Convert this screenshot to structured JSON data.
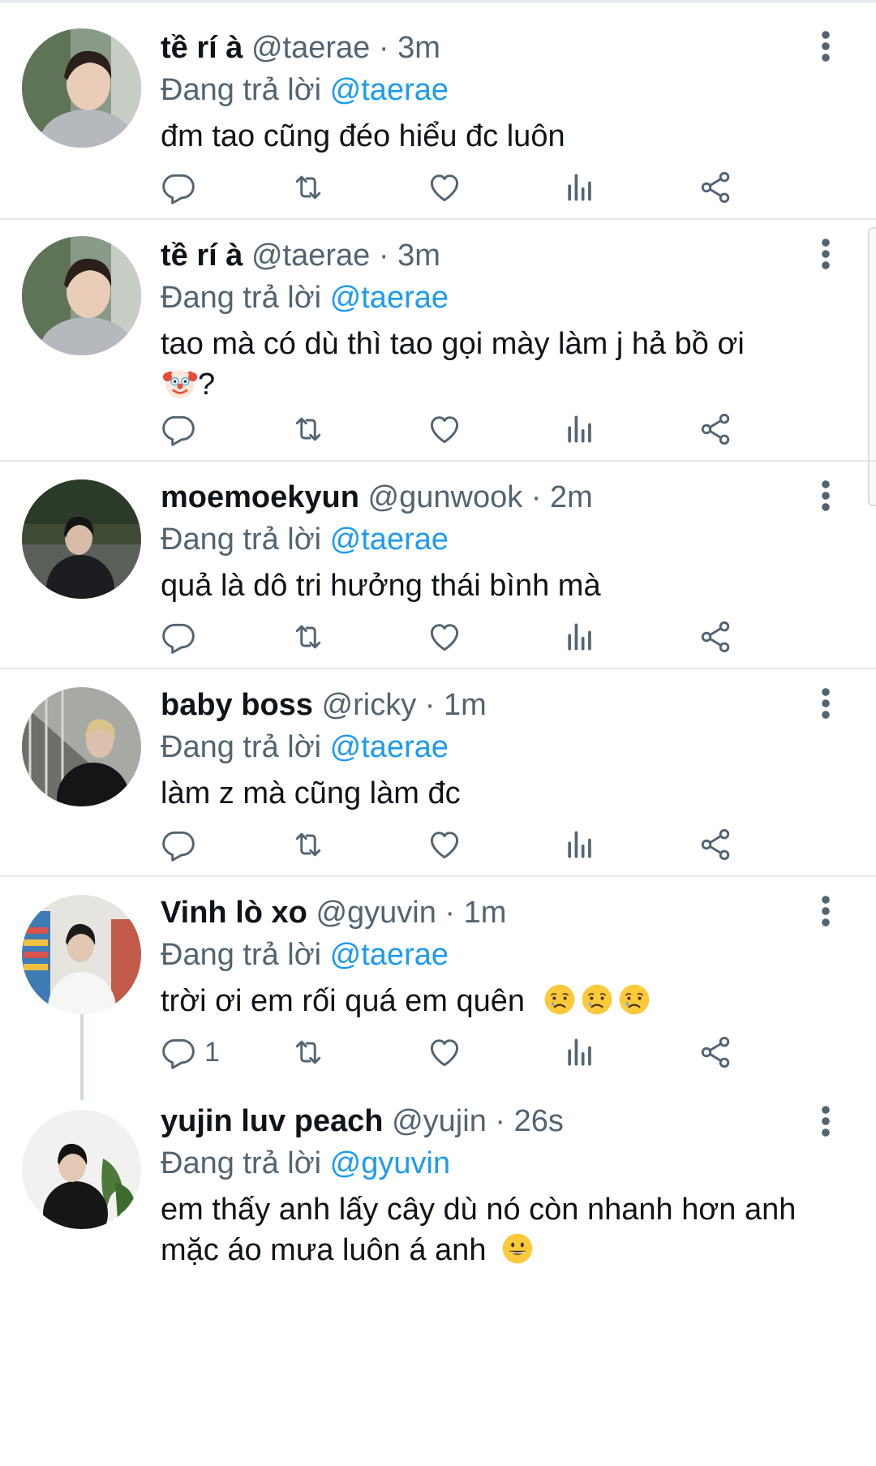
{
  "reply_prefix": "Đang trả lời",
  "colors": {
    "text_primary": "#0f1419",
    "text_secondary": "#536471",
    "mention": "#1d9bf0",
    "divider": "#e6e9eb"
  },
  "icons": [
    "reply-icon",
    "retweet-icon",
    "like-icon",
    "analytics-icon",
    "share-icon",
    "more-icon"
  ],
  "tweets": [
    {
      "name": "tề rí à",
      "handle": "@taerae",
      "sep": "·",
      "time": "3m",
      "reply_to": "@taerae",
      "text": "đm tao cũng đéo hiểu đc luôn",
      "reply_count": ""
    },
    {
      "name": "tề rí à",
      "handle": "@taerae",
      "sep": "·",
      "time": "3m",
      "reply_to": "@taerae",
      "text": "tao mà có dù thì tao gọi mày làm j hả bồ ơi",
      "text_tail": "?",
      "reply_count": ""
    },
    {
      "name": "moemoekyun",
      "handle": "@gunwook",
      "sep": "·",
      "time": "2m",
      "reply_to": "@taerae",
      "text": "quả là dô tri hưởng thái bình mà",
      "reply_count": ""
    },
    {
      "name": "baby boss",
      "handle": "@ricky",
      "sep": "·",
      "time": "1m",
      "reply_to": "@taerae",
      "text": "làm z mà cũng làm đc",
      "reply_count": ""
    },
    {
      "name": "Vinh lò xo",
      "handle": "@gyuvin",
      "sep": "·",
      "time": "1m",
      "reply_to": "@taerae",
      "text": "trời ơi em rối quá em quên",
      "reply_count": "1"
    },
    {
      "name": "yujin luv peach",
      "handle": "@yujin",
      "sep": "·",
      "time": "26s",
      "reply_to": "@gyuvin",
      "text": "em thấy anh lấy cây dù nó còn nhanh hơn anh mặc áo mưa luôn á anh",
      "reply_count": ""
    }
  ]
}
